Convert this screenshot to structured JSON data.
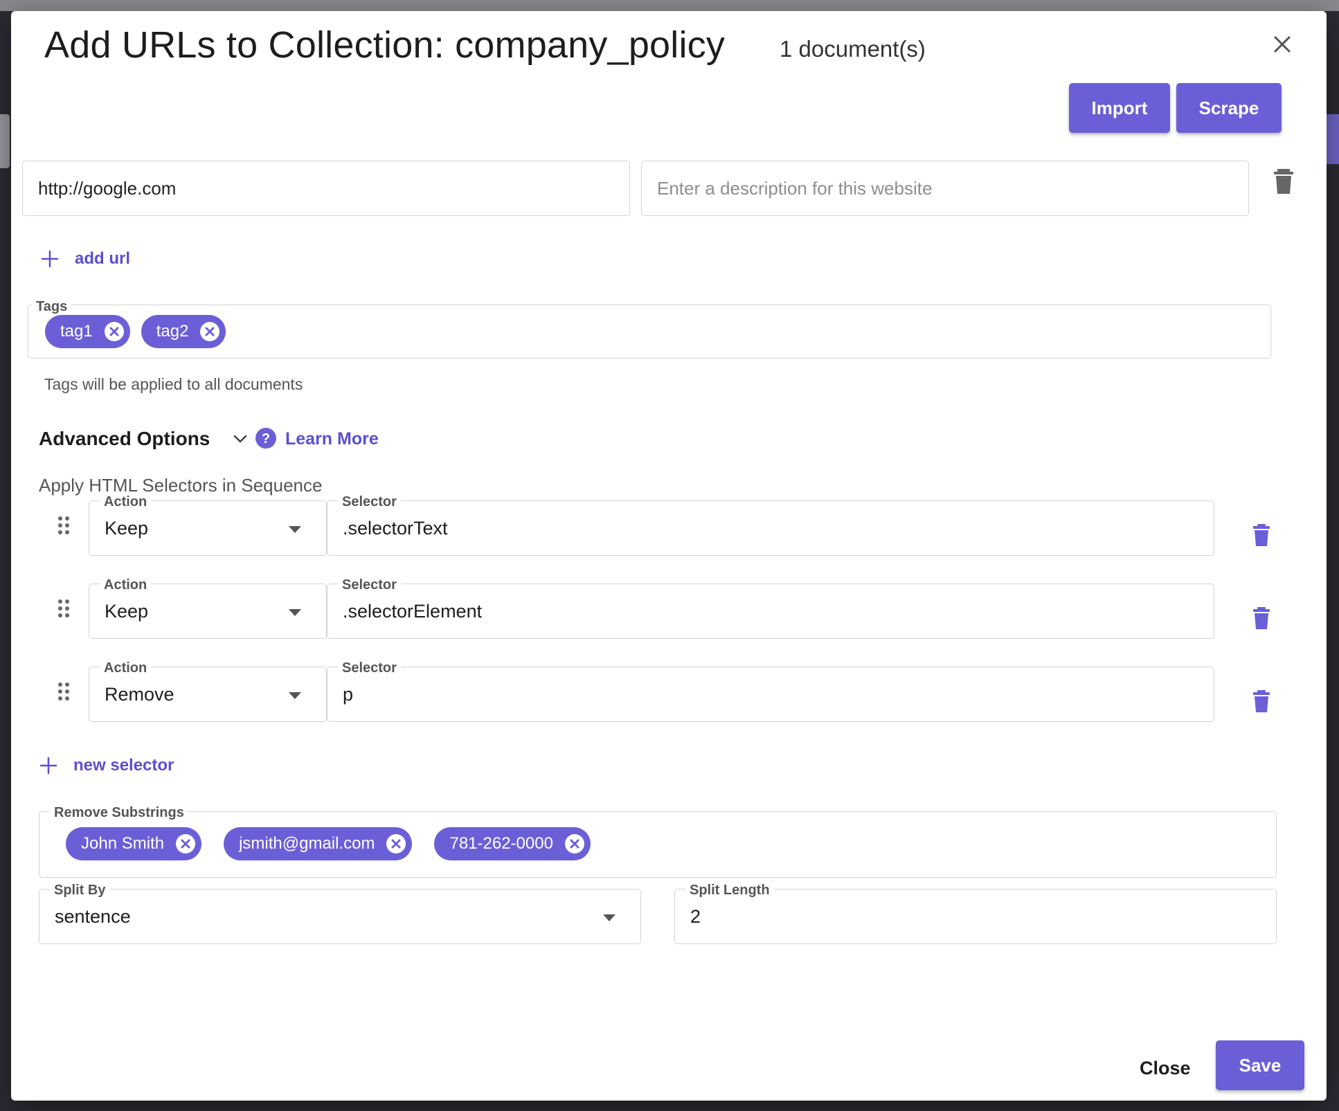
{
  "dialog": {
    "title": "Add URLs to Collection: company_policy",
    "doc_count": "1 document(s)",
    "import_label": "Import",
    "scrape_label": "Scrape",
    "close_label": "Close",
    "save_label": "Save"
  },
  "url_row": {
    "url_value": "http://google.com",
    "description_placeholder": "Enter a description for this website",
    "add_url_label": "add url"
  },
  "tags": {
    "label": "Tags",
    "items": [
      "tag1",
      "tag2"
    ],
    "hint": "Tags will be applied to all documents"
  },
  "advanced": {
    "title": "Advanced Options",
    "learn_more": "Learn More",
    "apply_label": "Apply HTML Selectors in Sequence",
    "selectors": [
      {
        "action_label": "Action",
        "action": "Keep",
        "selector_label": "Selector",
        "selector": ".selectorText"
      },
      {
        "action_label": "Action",
        "action": "Keep",
        "selector_label": "Selector",
        "selector": ".selectorElement"
      },
      {
        "action_label": "Action",
        "action": "Remove",
        "selector_label": "Selector",
        "selector": "p"
      }
    ],
    "new_selector_label": "new selector",
    "remove_substrings": {
      "label": "Remove Substrings",
      "items": [
        "John Smith",
        "jsmith@gmail.com",
        "781-262-0000"
      ]
    },
    "split_by": {
      "label": "Split By",
      "value": "sentence"
    },
    "split_length": {
      "label": "Split Length",
      "value": "2"
    }
  },
  "colors": {
    "accent": "#6b5fd8",
    "link": "#5b4fd1",
    "backdrop": "#2b2c33"
  },
  "icons": {
    "close": "close-icon",
    "trash": "trash-icon",
    "plus": "plus-icon",
    "chip_remove": "chip-remove-icon",
    "chevron": "chevron-down-icon",
    "help": "help-circle-icon",
    "drag": "drag-handle-icon",
    "dropdown": "dropdown-caret-icon"
  }
}
